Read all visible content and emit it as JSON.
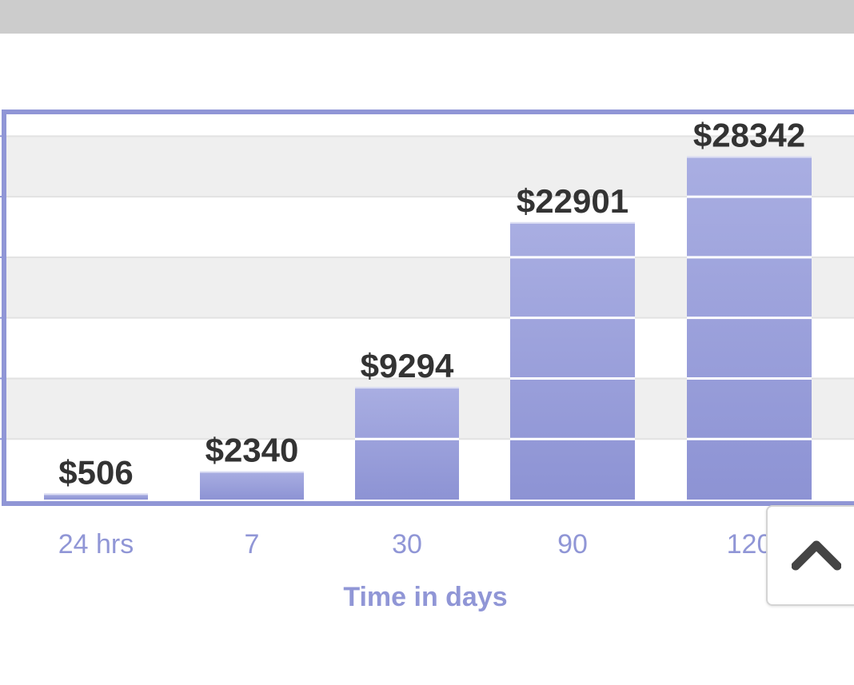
{
  "chart_data": {
    "type": "bar",
    "categories": [
      "24 hrs",
      "7",
      "30",
      "90",
      "120"
    ],
    "values": [
      506,
      2340,
      9294,
      22901,
      28342
    ],
    "data_labels": [
      "$506",
      "$2340",
      "$9294",
      "$22901",
      "$28342"
    ],
    "xlabel": "Time in days",
    "ylabel": "",
    "ylim": [
      0,
      32000
    ],
    "grid": true,
    "colors": {
      "bar": "#9aa0dc",
      "bar_dark": "#8b91d3",
      "frame": "#9096d6",
      "axis_text": "#9096d6",
      "label_text": "#333333",
      "band": "#efefef"
    }
  },
  "ui": {
    "scroll_top_icon": "chevron-up-icon"
  }
}
